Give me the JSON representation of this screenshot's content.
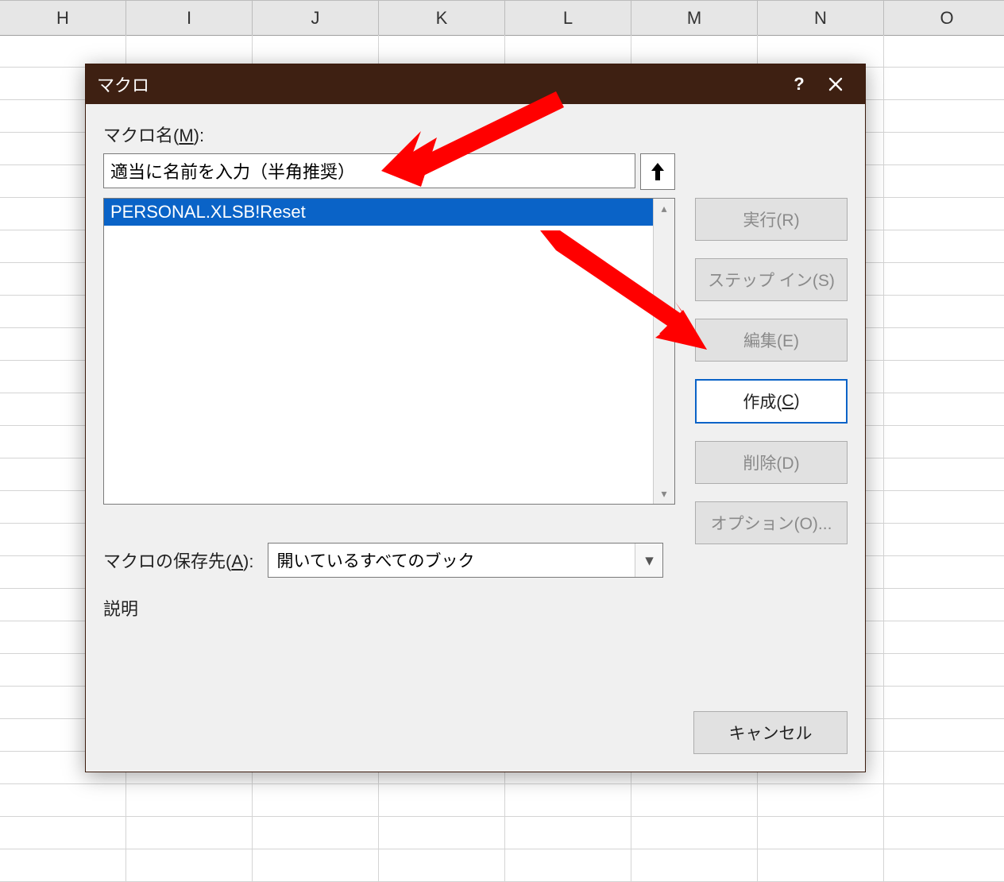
{
  "columns": [
    "H",
    "I",
    "J",
    "K",
    "L",
    "M",
    "N",
    "O"
  ],
  "dialog": {
    "title": "マクロ",
    "help_label": "?",
    "name_label_prefix": "マクロ名(",
    "name_label_hotkey": "M",
    "name_label_suffix": "):",
    "name_value": "適当に名前を入力（半角推奨）",
    "list_items": [
      "PERSONAL.XLSB!Reset"
    ],
    "selected_index": 0,
    "save_label_prefix": "マクロの保存先(",
    "save_label_hotkey": "A",
    "save_label_suffix": "):",
    "save_value": "開いているすべてのブック",
    "description_label": "説明",
    "buttons": {
      "run": "実行(R)",
      "step_in": "ステップ イン(S)",
      "edit": "編集(E)",
      "create_prefix": "作成(",
      "create_hotkey": "C",
      "create_suffix": ")",
      "delete": "削除(D)",
      "options": "オプション(O)..."
    },
    "cancel": "キャンセル"
  }
}
